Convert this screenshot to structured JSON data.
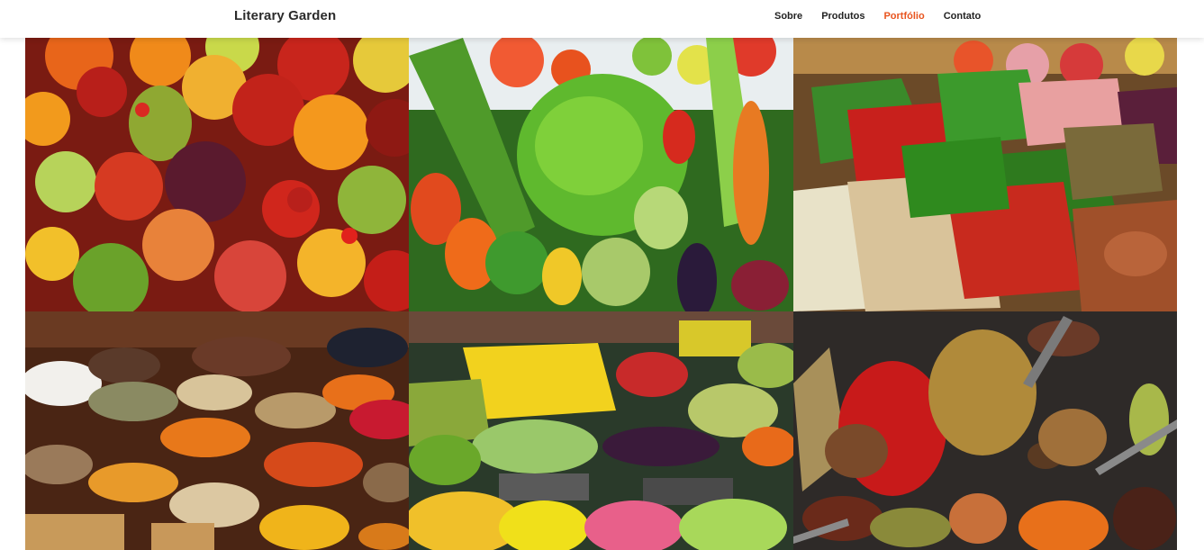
{
  "header": {
    "brand": "Literary Garden",
    "nav": [
      {
        "label": "Sobre",
        "active": false
      },
      {
        "label": "Produtos",
        "active": false
      },
      {
        "label": "Portfólio",
        "active": true
      },
      {
        "label": "Contato",
        "active": false
      }
    ],
    "accent_color": "#e8541e"
  },
  "portfolio": {
    "tiles": [
      {
        "subject": "fruits"
      },
      {
        "subject": "vegetables"
      },
      {
        "subject": "market-baskets"
      },
      {
        "subject": "spice-bowls"
      },
      {
        "subject": "fruit-stall"
      },
      {
        "subject": "spices-on-slate"
      }
    ]
  }
}
